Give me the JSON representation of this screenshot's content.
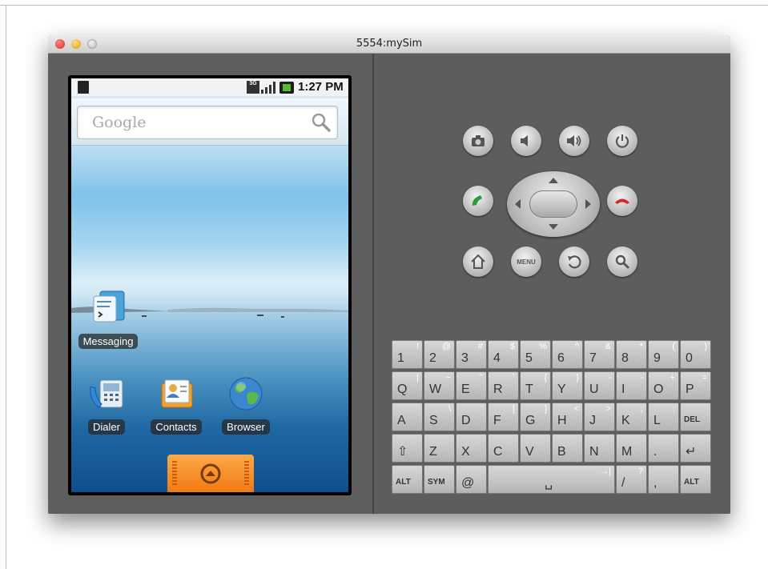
{
  "window": {
    "title": "5554:mySim"
  },
  "statusbar": {
    "network": "3G",
    "time": "1:27 PM"
  },
  "search": {
    "placeholder": "Google"
  },
  "apps": [
    {
      "label": "Messaging"
    },
    {
      "label": "Dialer"
    },
    {
      "label": "Contacts"
    },
    {
      "label": "Browser"
    }
  ],
  "hardware": {
    "menu_label": "MENU"
  },
  "keyboard": {
    "rows": [
      [
        {
          "main": "1",
          "alt": "!"
        },
        {
          "main": "2",
          "alt": "@"
        },
        {
          "main": "3",
          "alt": "#"
        },
        {
          "main": "4",
          "alt": "$"
        },
        {
          "main": "5",
          "alt": "%"
        },
        {
          "main": "6",
          "alt": "^"
        },
        {
          "main": "7",
          "alt": "&"
        },
        {
          "main": "8",
          "alt": "*"
        },
        {
          "main": "9",
          "alt": "("
        },
        {
          "main": "0",
          "alt": ")"
        }
      ],
      [
        {
          "main": "Q",
          "alt": "|"
        },
        {
          "main": "W",
          "alt": "~"
        },
        {
          "main": "E",
          "alt": "\""
        },
        {
          "main": "R",
          "alt": "`"
        },
        {
          "main": "T",
          "alt": "{"
        },
        {
          "main": "Y",
          "alt": "}"
        },
        {
          "main": "U",
          "alt": "-"
        },
        {
          "main": "I",
          "alt": "-"
        },
        {
          "main": "O",
          "alt": "+"
        },
        {
          "main": "P",
          "alt": "="
        }
      ],
      [
        {
          "main": "A",
          "alt": ""
        },
        {
          "main": "S",
          "alt": "\\"
        },
        {
          "main": "D",
          "alt": "'"
        },
        {
          "main": "F",
          "alt": "["
        },
        {
          "main": "G",
          "alt": "]"
        },
        {
          "main": "H",
          "alt": "<"
        },
        {
          "main": "J",
          "alt": ">"
        },
        {
          "main": "K",
          "alt": ";"
        },
        {
          "main": "L",
          "alt": ":"
        },
        {
          "main": "DEL",
          "alt": ""
        }
      ],
      [
        {
          "main": "⇧",
          "alt": ""
        },
        {
          "main": "Z",
          "alt": ""
        },
        {
          "main": "X",
          "alt": ""
        },
        {
          "main": "C",
          "alt": ""
        },
        {
          "main": "V",
          "alt": ""
        },
        {
          "main": "B",
          "alt": ""
        },
        {
          "main": "N",
          "alt": ""
        },
        {
          "main": "M",
          "alt": ""
        },
        {
          "main": ".",
          "alt": ""
        },
        {
          "main": "↵",
          "alt": ""
        }
      ]
    ],
    "bottom_row": [
      {
        "main": "ALT",
        "alt": ""
      },
      {
        "main": "SYM",
        "alt": ""
      },
      {
        "main": "@",
        "alt": ""
      },
      {
        "main": "␣",
        "alt": "→|"
      },
      {
        "main": "/",
        "alt": "?"
      },
      {
        "main": ",",
        "alt": ""
      },
      {
        "main": "ALT",
        "alt": ""
      }
    ]
  },
  "colors": {
    "drawer_orange": "#f08a20",
    "call_green": "#2a9a3a",
    "end_red": "#d02a2a"
  }
}
